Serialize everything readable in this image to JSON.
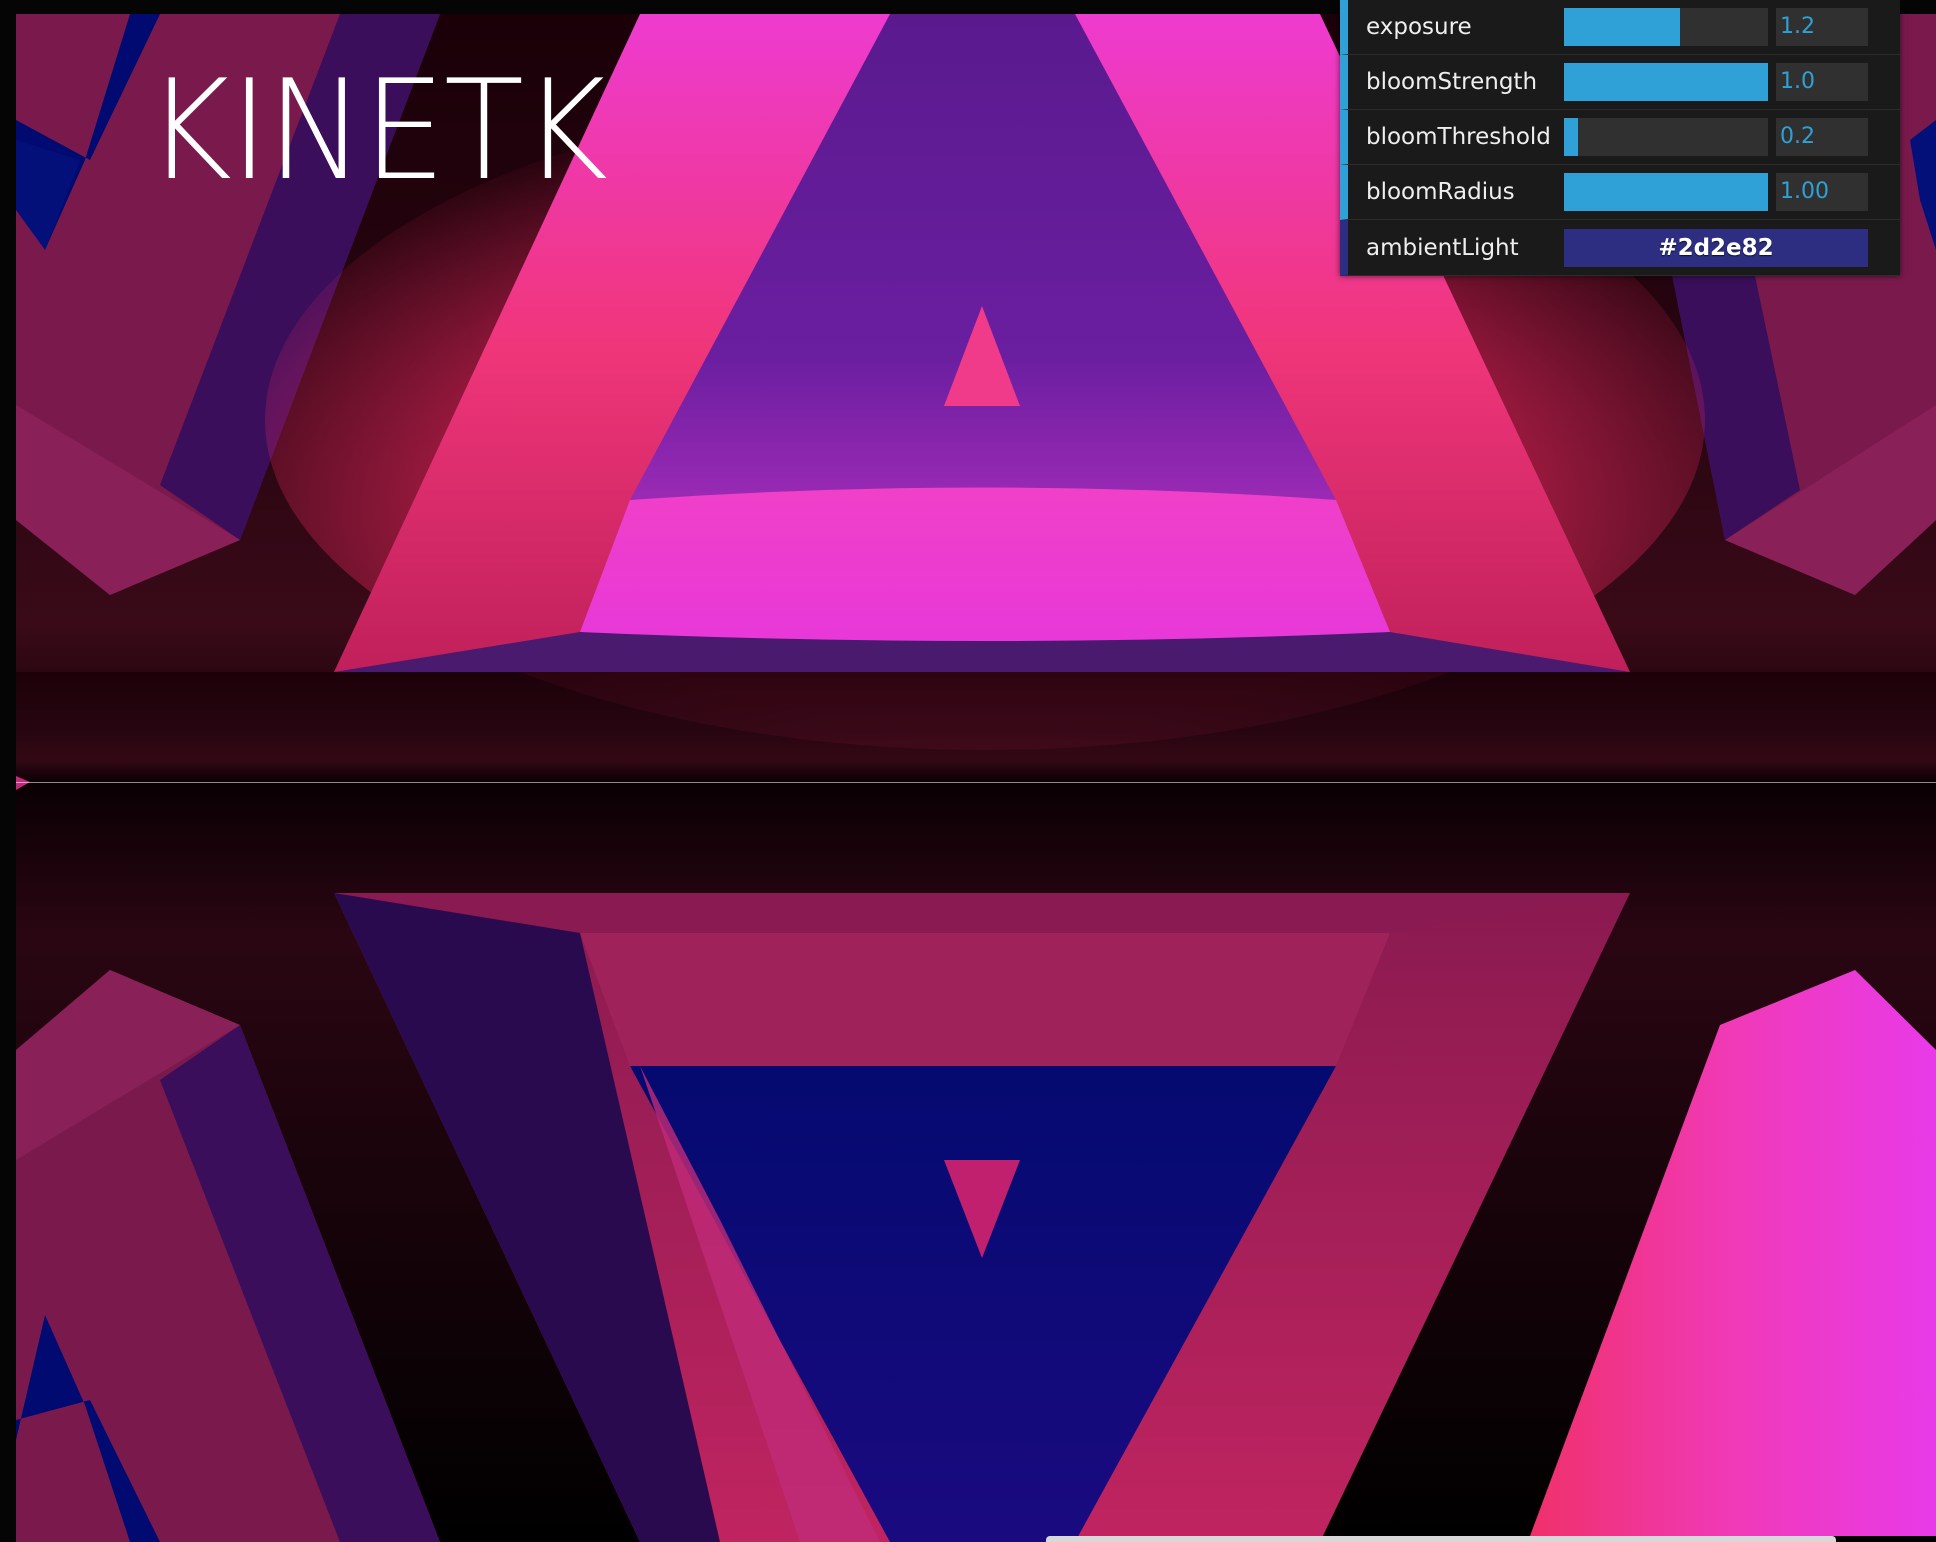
{
  "app": {
    "logo_text": "KINETK"
  },
  "gui": {
    "controls": [
      {
        "label": "exposure",
        "value": "1.2",
        "fill": 0.57
      },
      {
        "label": "bloomStrength",
        "value": "1.0",
        "fill": 1.0
      },
      {
        "label": "bloomThreshold",
        "value": "0.2",
        "fill": 0.07
      },
      {
        "label": "bloomRadius",
        "value": "1.00",
        "fill": 1.0
      }
    ],
    "color_control": {
      "label": "ambientLight",
      "value": "#2d2e82"
    }
  },
  "colors": {
    "accent": "#2fa1d6",
    "ambient": "#2d2e82",
    "magenta": "#e83ad6",
    "pink": "#f0336e",
    "deep_purple": "#4a1a7e",
    "navy": "#0a0a6e",
    "maroon": "#7a1a4c"
  }
}
